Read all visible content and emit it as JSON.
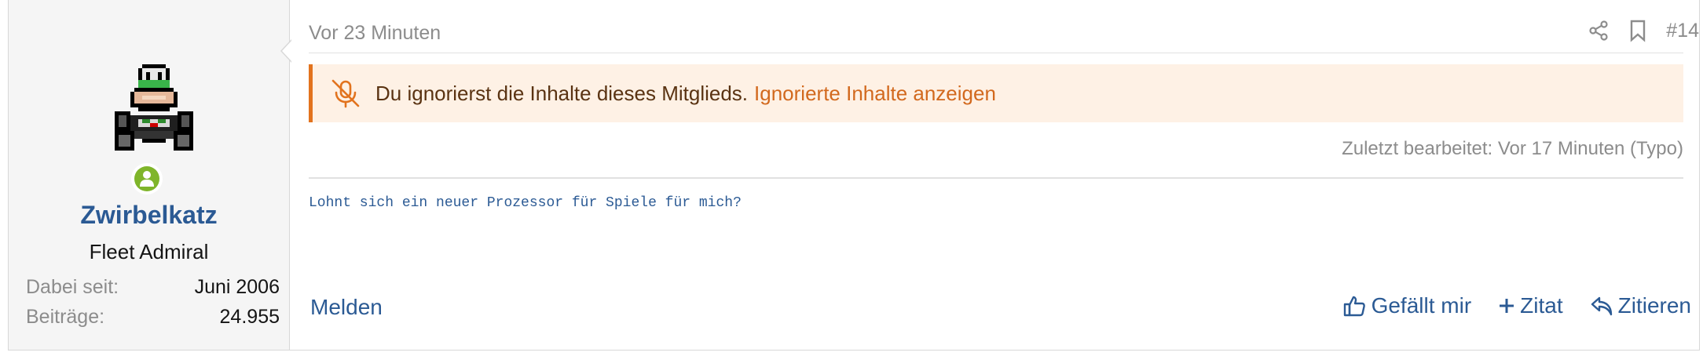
{
  "user": {
    "name": "Zwirbelkatz",
    "title": "Fleet Admiral",
    "stats": [
      {
        "label": "Dabei seit:",
        "value": "Juni 2006"
      },
      {
        "label": "Beiträge:",
        "value": "24.955"
      }
    ]
  },
  "post": {
    "date": "Vor 23 Minuten",
    "number": "#14",
    "notice_text": "Du ignorierst die Inhalte dieses Mitglieds.",
    "notice_link": "Ignorierte Inhalte anzeigen",
    "edited": "Zuletzt bearbeitet: Vor 17 Minuten (Typo)",
    "body": "Lohnt sich ein neuer Prozessor für Spiele für mich?"
  },
  "actions": {
    "report": "Melden",
    "like": "Gefällt mir",
    "quote_plus": "Zitat",
    "reply": "Zitieren"
  },
  "colors": {
    "accent": "#2b5a94",
    "notice_bg": "#fef1e5",
    "notice_border": "#e2731e",
    "online": "#7fb52a"
  }
}
